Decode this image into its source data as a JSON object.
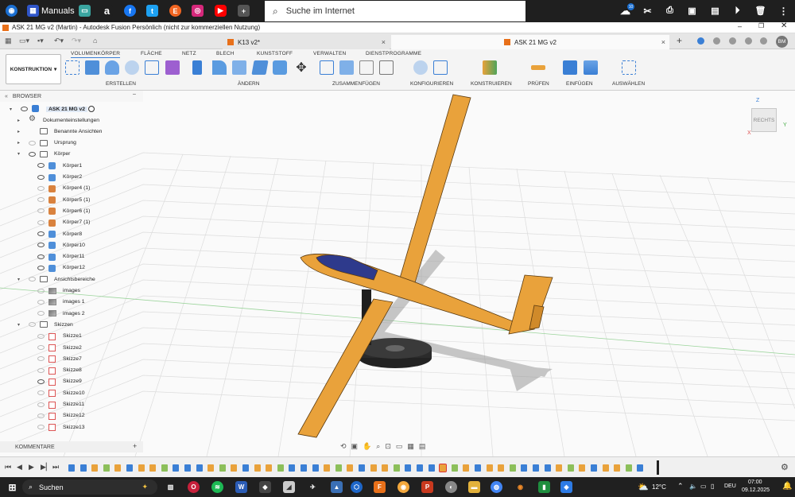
{
  "top_bar": {
    "manuals_label": "Manuals",
    "search_placeholder": "Suche im Internet",
    "icons": [
      "windows-logo-icon",
      "manuals-icon",
      "amazon-icon",
      "facebook-icon",
      "twitter-icon",
      "etsy-icon",
      "instagram-icon",
      "youtube-icon",
      "add-tile-icon",
      "cloud-icon",
      "scissors-icon",
      "print-icon",
      "video-icon",
      "notes-icon",
      "play-icon",
      "trash-icon"
    ],
    "cloud_badge": "10"
  },
  "title_bar": {
    "title": "ASK 21 MG v2 (Martin) - Autodesk Fusion Persönlich (nicht zur kommerziellen Nutzung)"
  },
  "tabs": [
    {
      "label": "K13 v2*",
      "close": "×"
    },
    {
      "label": "ASK 21 MG v2",
      "close": "×",
      "active": true
    }
  ],
  "tab_bar": {
    "user_initials": "BM",
    "add": "+"
  },
  "workspace": {
    "label": "KONSTRUKTION"
  },
  "ribbon_tabs": [
    "VOLUMENKÖRPER",
    "FLÄCHE",
    "NETZ",
    "BLECH",
    "KUNSTSTOFF",
    "VERWALTEN",
    "DIENSTPROGRAMME"
  ],
  "ribbon_groups": [
    "ERSTELLEN",
    "ÄNDERN",
    "ZUSAMMENFÜGEN",
    "KONFIGURIEREN",
    "KONSTRUIEREN",
    "PRÜFEN",
    "EINFÜGEN",
    "AUSWÄHLEN"
  ],
  "browser": {
    "title": "BROWSER",
    "root": "ASK 21 MG v2",
    "items": [
      {
        "label": "Dokumenteinstellungen",
        "icon": "gear-icon"
      },
      {
        "label": "Benannte Ansichten",
        "icon": "folder-icon"
      },
      {
        "label": "Ursprung",
        "icon": "folder-icon"
      },
      {
        "label": "Körper",
        "icon": "folder-icon"
      },
      {
        "label": "Körper1",
        "icon": "body-icon"
      },
      {
        "label": "Körper2",
        "icon": "body-icon"
      },
      {
        "label": "Körper4 (1)",
        "icon": "body-icon"
      },
      {
        "label": "Körper5 (1)",
        "icon": "body-icon"
      },
      {
        "label": "Körper6 (1)",
        "icon": "body-icon"
      },
      {
        "label": "Körper7 (1)",
        "icon": "body-icon"
      },
      {
        "label": "Körper8",
        "icon": "body-icon"
      },
      {
        "label": "Körper10",
        "icon": "body-icon"
      },
      {
        "label": "Körper11",
        "icon": "body-icon"
      },
      {
        "label": "Körper12",
        "icon": "body-icon"
      },
      {
        "label": "Ansichtsbereiche",
        "icon": "folder-icon"
      },
      {
        "label": "images",
        "icon": "image-icon"
      },
      {
        "label": "images 1",
        "icon": "image-icon"
      },
      {
        "label": "images 2",
        "icon": "image-icon"
      },
      {
        "label": "Skizzen",
        "icon": "folder-icon"
      },
      {
        "label": "Skizze1",
        "icon": "sketch-icon"
      },
      {
        "label": "Skizze2",
        "icon": "sketch-icon"
      },
      {
        "label": "Skizze7",
        "icon": "sketch-icon"
      },
      {
        "label": "Skizze8",
        "icon": "sketch-icon"
      },
      {
        "label": "Skizze9",
        "icon": "sketch-icon"
      },
      {
        "label": "Skizze10",
        "icon": "sketch-icon"
      },
      {
        "label": "Skizze11",
        "icon": "sketch-icon"
      },
      {
        "label": "Skizze12",
        "icon": "sketch-icon"
      },
      {
        "label": "Skizze13",
        "icon": "sketch-icon"
      }
    ]
  },
  "viewcube": {
    "label": "RECHTS",
    "axes": [
      "Z",
      "X",
      "Y"
    ]
  },
  "comments": {
    "label": "KOMMENTARE",
    "add": "+"
  },
  "taskbar": {
    "search_label": "Suchen",
    "temperature": "12°C",
    "language": "DEU",
    "time": "07:00",
    "date": "09.12.2025"
  },
  "colors": {
    "glider": "#e9a23b",
    "canopy": "#2e3a8c",
    "stand": "#2b2b2b",
    "accent_blue": "#3a7fd5"
  }
}
